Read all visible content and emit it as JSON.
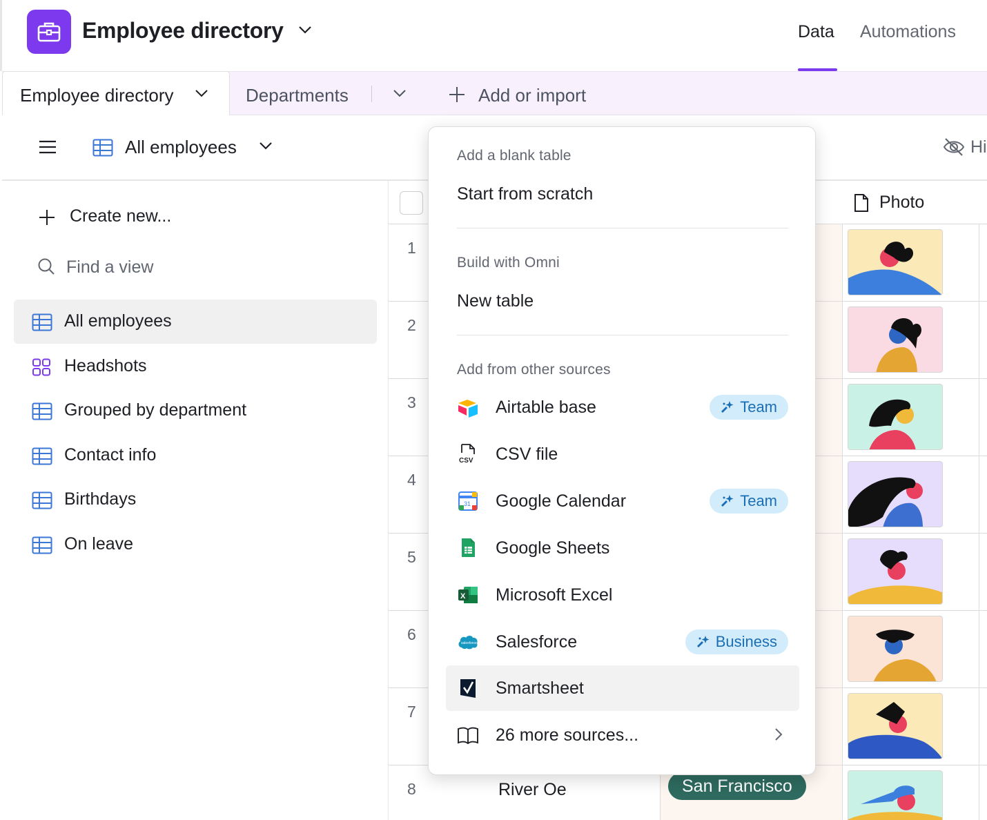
{
  "header": {
    "base_title": "Employee directory",
    "nav": {
      "data": "Data",
      "automations": "Automations"
    },
    "accent_color": "#7c39ed"
  },
  "tabs": {
    "active": "Employee directory",
    "second": "Departments",
    "add": "Add or import"
  },
  "viewbar": {
    "view_name": "All employees",
    "hide_label": "Hi"
  },
  "sidebar": {
    "create": "Create new...",
    "find_placeholder": "Find a view",
    "views": [
      {
        "label": "All employees",
        "icon": "grid-view-icon",
        "selected": true
      },
      {
        "label": "Headshots",
        "icon": "gallery-view-icon",
        "selected": false
      },
      {
        "label": "Grouped by department",
        "icon": "grid-view-icon",
        "selected": false
      },
      {
        "label": "Contact info",
        "icon": "grid-view-icon",
        "selected": false
      },
      {
        "label": "Birthdays",
        "icon": "grid-view-icon",
        "selected": false
      },
      {
        "label": "On leave",
        "icon": "grid-view-icon",
        "selected": false
      }
    ]
  },
  "grid": {
    "photo_header": "Photo",
    "rows": [
      {
        "num": "1",
        "photo_bg": "#fbe9b7"
      },
      {
        "num": "2",
        "photo_bg": "#fbdbe3"
      },
      {
        "num": "3",
        "photo_bg": "#c9f1e6"
      },
      {
        "num": "4",
        "photo_bg": "#e6dcfb"
      },
      {
        "num": "5",
        "photo_bg": "#e6dcfb"
      },
      {
        "num": "6",
        "photo_bg": "#fbe3d6"
      },
      {
        "num": "7",
        "photo_bg": "#fbe9b7"
      },
      {
        "num": "8",
        "photo_bg": "#c9f1e6",
        "name": "River Oe",
        "city": "San Francisco"
      }
    ]
  },
  "menu": {
    "blank_section": "Add a blank table",
    "start_scratch": "Start from scratch",
    "omni_section": "Build with Omni",
    "new_table": "New table",
    "other_section": "Add from other sources",
    "sources": [
      {
        "label": "Airtable base",
        "icon": "airtable-icon",
        "badge": "Team"
      },
      {
        "label": "CSV file",
        "icon": "csv-file-icon"
      },
      {
        "label": "Google Calendar",
        "icon": "google-calendar-icon",
        "badge": "Team"
      },
      {
        "label": "Google Sheets",
        "icon": "google-sheets-icon"
      },
      {
        "label": "Microsoft Excel",
        "icon": "excel-icon"
      },
      {
        "label": "Salesforce",
        "icon": "salesforce-icon",
        "badge": "Business"
      },
      {
        "label": "Smartsheet",
        "icon": "smartsheet-icon",
        "hover": true
      },
      {
        "label": "26 more sources...",
        "icon": "book-icon"
      }
    ]
  }
}
